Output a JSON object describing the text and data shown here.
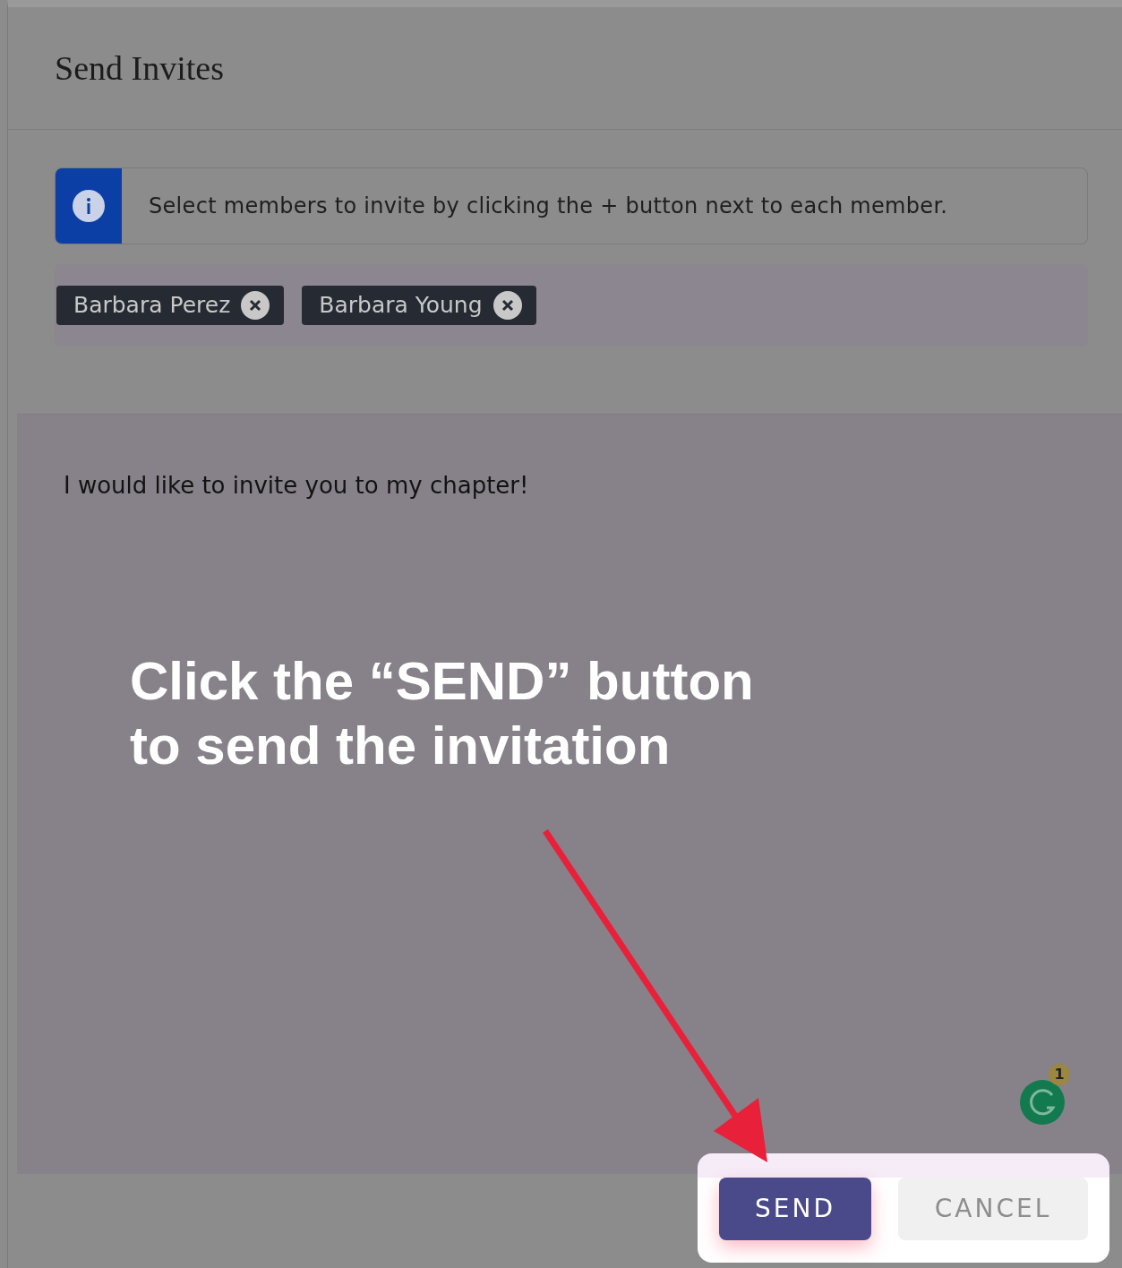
{
  "header": {
    "title": "Send Invites"
  },
  "info_alert": {
    "text": "Select members to invite by clicking the + button next to each member."
  },
  "selected_members": [
    {
      "name": "Barbara Perez"
    },
    {
      "name": "Barbara Young"
    }
  ],
  "message": {
    "value": "I would like to invite you to my chapter!"
  },
  "grammar_badge": {
    "count": "1"
  },
  "annotation": {
    "lines": [
      "Click the “SEND” button",
      "to send the invitation"
    ]
  },
  "buttons": [
    {
      "label": "SEND",
      "kind": "primary"
    },
    {
      "label": "CANCEL",
      "kind": "secondary"
    }
  ]
}
